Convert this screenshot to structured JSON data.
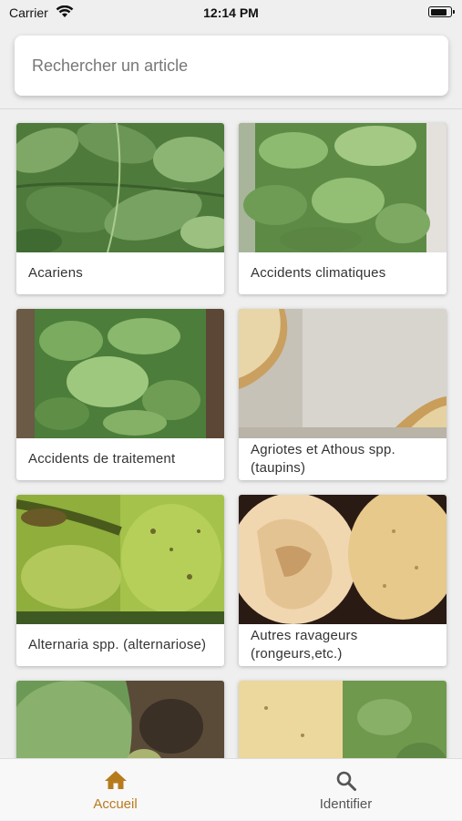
{
  "status_bar": {
    "carrier": "Carrier",
    "time": "12:14 PM",
    "battery_level": 0.85
  },
  "search": {
    "placeholder": "Rechercher un article"
  },
  "articles": [
    {
      "title": "Acariens",
      "image": "potato-leaves-photo"
    },
    {
      "title": "Accidents climatiques",
      "image": "potato-plant-photo"
    },
    {
      "title": "Accidents de traitement",
      "image": "potato-plant-photo"
    },
    {
      "title": "Agriotes et Athous spp. (taupins)",
      "image": "tuber-damage-photo"
    },
    {
      "title": "Alternaria spp. (alternariose)",
      "image": "leaf-disease-photo"
    },
    {
      "title": "Autres ravageurs (rongeurs,etc.)",
      "image": "gnawed-tuber-photo"
    },
    {
      "title": "",
      "image": "leaf-disease-photo"
    },
    {
      "title": "",
      "image": "tuber-and-plant-photo"
    }
  ],
  "tabs": [
    {
      "label": "Accueil",
      "icon": "home-icon",
      "active": true
    },
    {
      "label": "Identifier",
      "icon": "search-icon",
      "active": false
    }
  ],
  "colors": {
    "accent": "#b77b1e",
    "inactive": "#555555",
    "background": "#efefef"
  }
}
